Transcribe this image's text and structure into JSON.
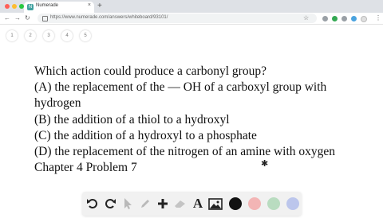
{
  "browser": {
    "tab_title": "Numerade",
    "favicon_letter": "N",
    "url": "https://www.numerade.com/answers/whiteboard/93101/",
    "traffic_colors": [
      "#ff5f57",
      "#febc2e",
      "#28c840"
    ]
  },
  "pager": {
    "pages": [
      "1",
      "2",
      "3",
      "4",
      "5"
    ]
  },
  "question": {
    "lines": [
      "Which action could produce a carbonyl group?",
      "(A) the replacement of the — OH of a carboxyl group with",
      "hydrogen",
      "(B) the addition of a thiol to a hydroxyl",
      "(C) the addition of a hydroxyl to a phosphate",
      "(D) the replacement of the nitrogen of an amine with oxygen",
      "Chapter 4 Problem 7"
    ]
  },
  "toolbar": {
    "tools": [
      "undo-icon",
      "redo-icon",
      "select-arrow-icon",
      "pen-icon",
      "add-icon",
      "eraser-icon",
      "text-tool-icon",
      "image-icon"
    ],
    "text_tool_glyph": "A",
    "colors": [
      "#111111",
      "#f3b5b5",
      "#b9dcc0",
      "#bcc6ec"
    ]
  }
}
